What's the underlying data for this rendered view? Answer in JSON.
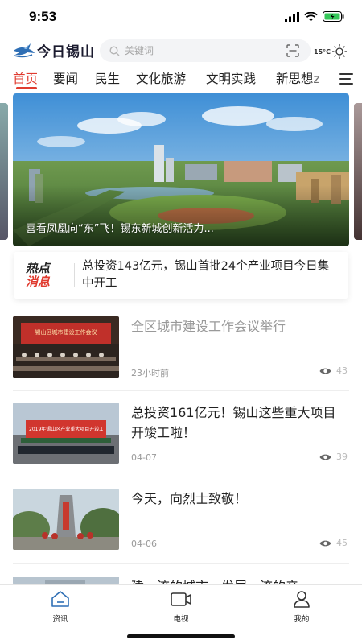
{
  "status_bar": {
    "time": "9:53"
  },
  "header": {
    "logo_text": "今日锡山",
    "search_placeholder": "关键词",
    "temperature": "15°C"
  },
  "tabs": [
    {
      "label": "首页",
      "active": true
    },
    {
      "label": "要闻"
    },
    {
      "label": "民生"
    },
    {
      "label": "文化旅游"
    },
    {
      "label": "文明实践"
    },
    {
      "label": "新思想z"
    }
  ],
  "banner": {
    "caption": "喜看凤凰向“东”飞！锡东新城创新活力..."
  },
  "hot_news": {
    "badge_line1": "热点",
    "badge_line2": "消息",
    "text": "总投资143亿元，锡山首批24个产业项目今日集中开工"
  },
  "news": [
    {
      "title": "全区城市建设工作会议举行",
      "date": "23小时前",
      "views": "43",
      "thumb_text": "锡山区城市建设工作会议"
    },
    {
      "title": "总投资161亿元！锡山这些重大项目开竣工啦！",
      "date": "04-07",
      "views": "39",
      "thumb_text": "2019年锡山区产业重大项目开竣工"
    },
    {
      "title": "今天，向烈士致敬！",
      "date": "04-06",
      "views": "45"
    },
    {
      "title": "建一流的城市，发展一流的产"
    }
  ],
  "bottom_nav": [
    {
      "label": "资讯",
      "icon": "home-icon"
    },
    {
      "label": "电视",
      "icon": "tv-icon"
    },
    {
      "label": "我的",
      "icon": "person-icon"
    }
  ],
  "colors": {
    "accent": "#e03b2f",
    "text": "#222222",
    "muted": "#999999"
  }
}
